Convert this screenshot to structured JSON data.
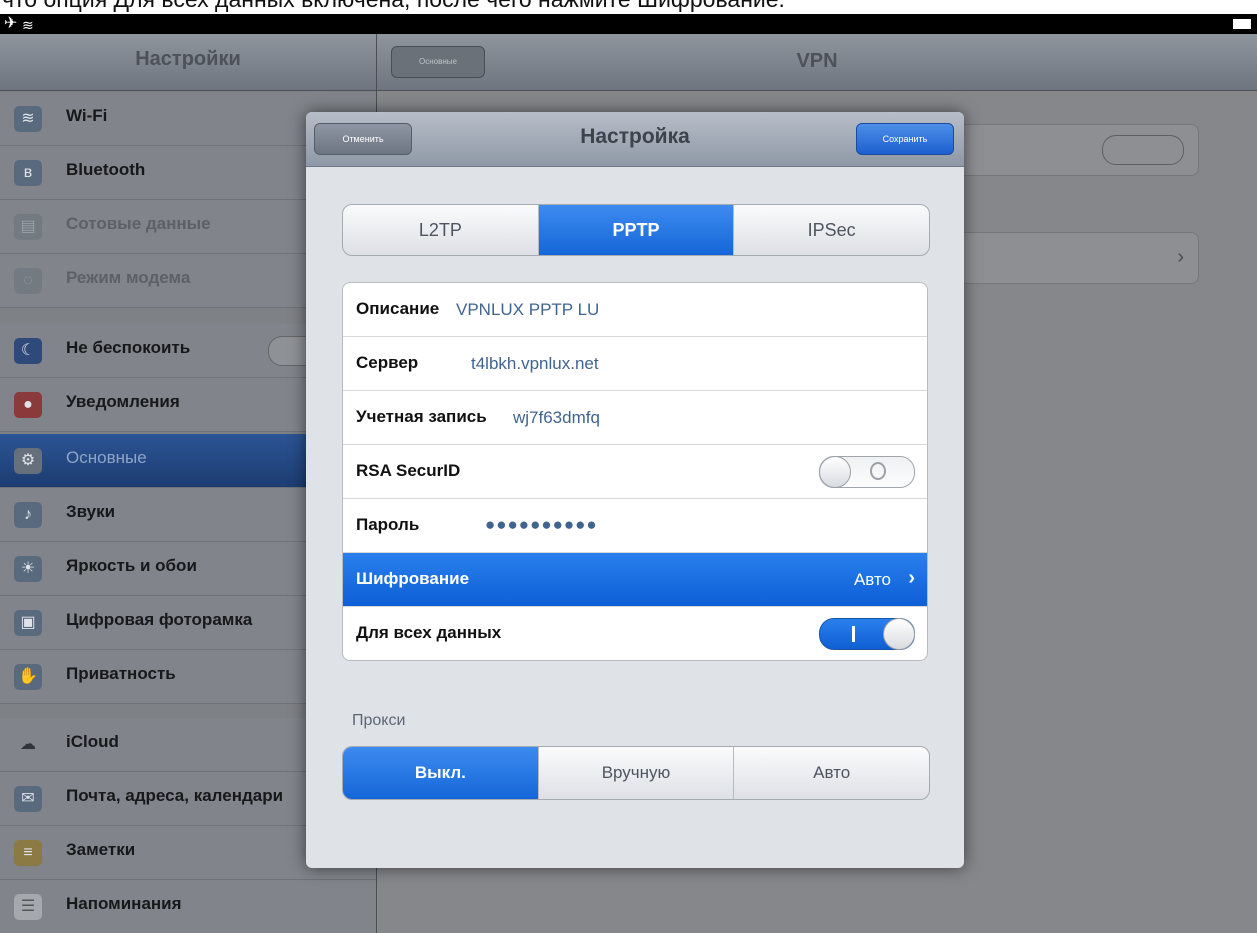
{
  "caption": "что опция Для всех данных включена, после чего нажмите Шифрование.",
  "status_bar": {
    "airplane_icon": "airplane-icon",
    "wifi_icon": "wifi-icon",
    "battery_icon": "battery-icon"
  },
  "sidebar": {
    "title": "Настройки",
    "groups": [
      [
        {
          "label": "Wi-Fi",
          "icon": "wifi-icon",
          "state": "normal"
        },
        {
          "label": "Bluetooth",
          "icon": "bluetooth-icon",
          "state": "normal"
        },
        {
          "label": "Сотовые данные",
          "icon": "cellular-icon",
          "state": "disabled"
        },
        {
          "label": "Режим модема",
          "icon": "hotspot-icon",
          "state": "disabled"
        }
      ],
      [
        {
          "label": "Не беспокоить",
          "icon": "moon-icon",
          "state": "normal",
          "has_switch": true
        },
        {
          "label": "Уведомления",
          "icon": "notifications-icon",
          "state": "normal"
        }
      ],
      [
        {
          "label": "Основные",
          "icon": "gear-icon",
          "state": "selected"
        },
        {
          "label": "Звуки",
          "icon": "sound-icon",
          "state": "normal"
        },
        {
          "label": "Яркость и обои",
          "icon": "brightness-icon",
          "state": "normal"
        },
        {
          "label": "Цифровая фоторамка",
          "icon": "photo-frame-icon",
          "state": "normal"
        },
        {
          "label": "Приватность",
          "icon": "privacy-icon",
          "state": "normal"
        }
      ],
      [
        {
          "label": "iCloud",
          "icon": "cloud-icon",
          "state": "normal"
        },
        {
          "label": "Почта, адреса, календари",
          "icon": "mail-icon",
          "state": "normal"
        },
        {
          "label": "Заметки",
          "icon": "notes-icon",
          "state": "normal"
        },
        {
          "label": "Напоминания",
          "icon": "reminders-icon",
          "state": "normal"
        }
      ]
    ]
  },
  "detail": {
    "back_label": "Основные",
    "title": "VPN"
  },
  "modal": {
    "cancel_label": "Отменить",
    "title": "Настройка",
    "save_label": "Сохранить",
    "vpn_types": [
      "L2TP",
      "PPTP",
      "IPSec"
    ],
    "vpn_type_selected": "PPTP",
    "fields": {
      "description": {
        "label": "Описание",
        "value": "VPNLUX PPTP LU"
      },
      "server": {
        "label": "Сервер",
        "value": "t4lbkh.vpnlux.net"
      },
      "account": {
        "label": "Учетная запись",
        "value": "wj7f63dmfq"
      },
      "rsa": {
        "label": "RSA SecurID",
        "enabled": false
      },
      "password": {
        "label": "Пароль",
        "value": "●●●●●●●●●●"
      },
      "encryption": {
        "label": "Шифрование",
        "value": "Авто"
      },
      "send_all": {
        "label": "Для всех данных",
        "enabled": true
      }
    },
    "proxy": {
      "label": "Прокси",
      "options": [
        "Выкл.",
        "Вручную",
        "Авто"
      ],
      "selected": "Выкл."
    }
  },
  "colors": {
    "accent": "#1567d8",
    "selected_row": "#1a6fe0",
    "sidebar_selected": "#234a86"
  }
}
